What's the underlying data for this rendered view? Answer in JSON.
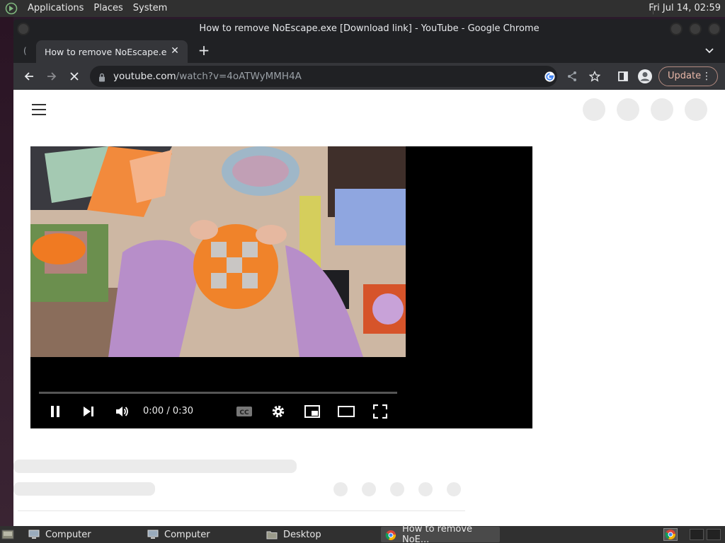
{
  "top_panel": {
    "menus": [
      "Applications",
      "Places",
      "System"
    ],
    "clock": "Fri Jul 14, 02:59"
  },
  "window": {
    "title": "How to remove NoEscape.exe [Download link] - YouTube - Google Chrome"
  },
  "tab": {
    "title": "How to remove NoEscape.exe [Download link] - YouTube",
    "spinner": "("
  },
  "omnibox": {
    "host": "youtube.com",
    "path": "/watch?v=4oATWyMMH4A"
  },
  "toolbar": {
    "update_label": "Update"
  },
  "player": {
    "time": "0:00 / 0:30",
    "cc_label": "CC",
    "progress": 0
  },
  "taskbar": {
    "tasks": [
      {
        "label": "Computer",
        "icon": "computer-icon"
      },
      {
        "label": "Computer",
        "icon": "computer-icon"
      },
      {
        "label": "Desktop",
        "icon": "folder-icon"
      },
      {
        "label": "How to remove NoE...",
        "icon": "chrome-icon"
      }
    ]
  },
  "colors": {
    "panel": "#303030",
    "chrome_frame": "#202124",
    "chrome_toolbar": "#35363a",
    "update_accent": "#e8b7a8"
  }
}
